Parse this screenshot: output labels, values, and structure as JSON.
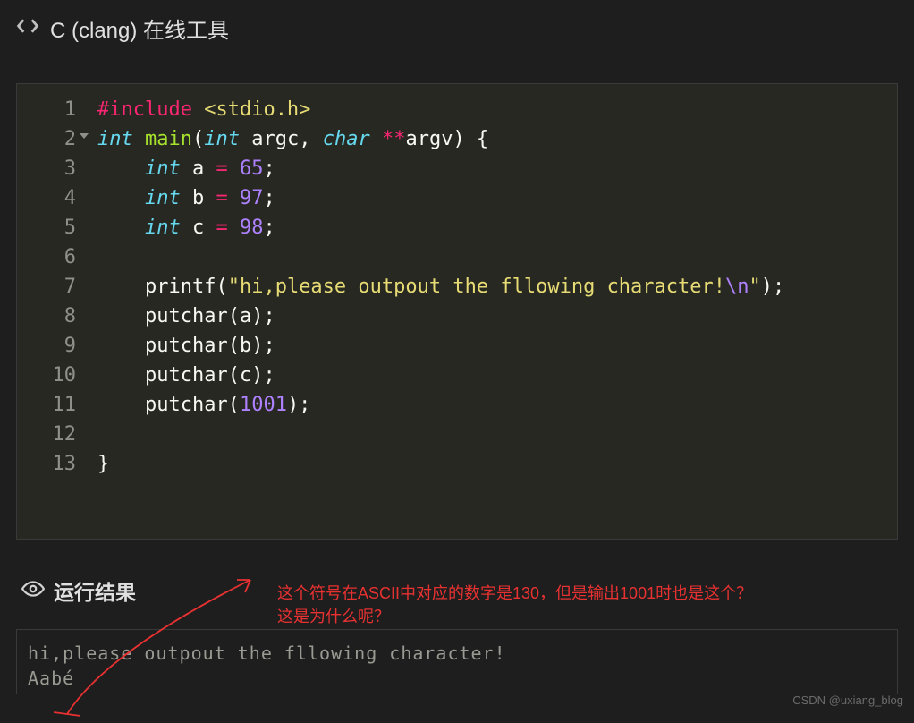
{
  "header": {
    "title": "C (clang) 在线工具"
  },
  "code": {
    "lines": [
      {
        "n": 1,
        "tokens": [
          [
            "pre",
            "#include"
          ],
          [
            "pn",
            " "
          ],
          [
            "inc",
            "<stdio.h>"
          ]
        ]
      },
      {
        "n": 2,
        "fold": true,
        "tokens": [
          [
            "kw",
            "int"
          ],
          [
            "pn",
            " "
          ],
          [
            "fn",
            "main"
          ],
          [
            "pn",
            "("
          ],
          [
            "kw",
            "int"
          ],
          [
            "pn",
            " "
          ],
          [
            "id",
            "argc"
          ],
          [
            "pn",
            ", "
          ],
          [
            "kw",
            "char"
          ],
          [
            "pn",
            " "
          ],
          [
            "op",
            "**"
          ],
          [
            "id",
            "argv"
          ],
          [
            "pn",
            ") {"
          ]
        ]
      },
      {
        "n": 3,
        "tokens": [
          [
            "pn",
            "    "
          ],
          [
            "kw",
            "int"
          ],
          [
            "pn",
            " "
          ],
          [
            "id",
            "a"
          ],
          [
            "pn",
            " "
          ],
          [
            "op",
            "="
          ],
          [
            "pn",
            " "
          ],
          [
            "num",
            "65"
          ],
          [
            "pn",
            ";"
          ]
        ]
      },
      {
        "n": 4,
        "tokens": [
          [
            "pn",
            "    "
          ],
          [
            "kw",
            "int"
          ],
          [
            "pn",
            " "
          ],
          [
            "id",
            "b"
          ],
          [
            "pn",
            " "
          ],
          [
            "op",
            "="
          ],
          [
            "pn",
            " "
          ],
          [
            "num",
            "97"
          ],
          [
            "pn",
            ";"
          ]
        ]
      },
      {
        "n": 5,
        "tokens": [
          [
            "pn",
            "    "
          ],
          [
            "kw",
            "int"
          ],
          [
            "pn",
            " "
          ],
          [
            "id",
            "c"
          ],
          [
            "pn",
            " "
          ],
          [
            "op",
            "="
          ],
          [
            "pn",
            " "
          ],
          [
            "num",
            "98"
          ],
          [
            "pn",
            ";"
          ]
        ]
      },
      {
        "n": 6,
        "tokens": [
          [
            "pn",
            "    "
          ]
        ]
      },
      {
        "n": 7,
        "tokens": [
          [
            "pn",
            "    "
          ],
          [
            "id",
            "printf"
          ],
          [
            "pn",
            "("
          ],
          [
            "str",
            "\"hi,please outpout the fllowing character!"
          ],
          [
            "esc",
            "\\n"
          ],
          [
            "str",
            "\""
          ],
          [
            "pn",
            ");"
          ]
        ]
      },
      {
        "n": 8,
        "tokens": [
          [
            "pn",
            "    "
          ],
          [
            "id",
            "putchar"
          ],
          [
            "pn",
            "("
          ],
          [
            "id",
            "a"
          ],
          [
            "pn",
            ");"
          ]
        ]
      },
      {
        "n": 9,
        "tokens": [
          [
            "pn",
            "    "
          ],
          [
            "id",
            "putchar"
          ],
          [
            "pn",
            "("
          ],
          [
            "id",
            "b"
          ],
          [
            "pn",
            ");"
          ]
        ]
      },
      {
        "n": 10,
        "tokens": [
          [
            "pn",
            "    "
          ],
          [
            "id",
            "putchar"
          ],
          [
            "pn",
            "("
          ],
          [
            "id",
            "c"
          ],
          [
            "pn",
            ");"
          ]
        ]
      },
      {
        "n": 11,
        "tokens": [
          [
            "pn",
            "    "
          ],
          [
            "id",
            "putchar"
          ],
          [
            "pn",
            "("
          ],
          [
            "num",
            "1001"
          ],
          [
            "pn",
            ");"
          ]
        ]
      },
      {
        "n": 12,
        "tokens": [
          [
            "pn",
            "    "
          ]
        ]
      },
      {
        "n": 13,
        "tokens": [
          [
            "pn",
            "}"
          ]
        ]
      }
    ]
  },
  "results": {
    "title": "运行结果",
    "output_line1": "hi,please outpout the fllowing character!",
    "output_line2": "Aabé"
  },
  "annotation": {
    "line1": "这个符号在ASCII中对应的数字是130，但是输出1001时也是这个？",
    "line2": "这是为什么呢？"
  },
  "watermark": "CSDN @uxiang_blog"
}
